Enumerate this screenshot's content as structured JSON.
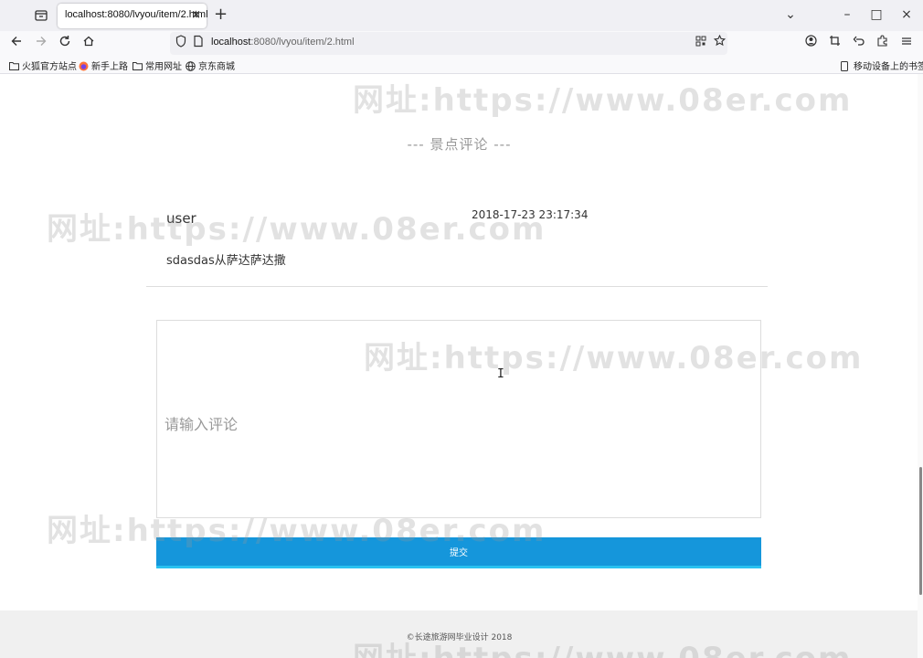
{
  "browser": {
    "tab_title": "localhost:8080/lvyou/item/2.html",
    "tab_close": "×",
    "new_tab": "+",
    "url_host": "localhost",
    "url_rest": ":8080/lvyou/item/2.html",
    "window_controls": {
      "collapse": "⌄",
      "minimize": "–",
      "maximize": "□",
      "close": "×"
    },
    "bookmarks": [
      {
        "label": "火狐官方站点",
        "icon": "folder-icon"
      },
      {
        "label": "新手上路",
        "icon": "firefox-icon"
      },
      {
        "label": "常用网址",
        "icon": "folder-icon"
      },
      {
        "label": "京东商城",
        "icon": "globe-icon"
      }
    ],
    "mobile_bookmarks": "移动设备上的书签"
  },
  "page": {
    "section_title": "--- 景点评论 ---",
    "comment": {
      "user": "user",
      "time": "2018-17-23 23:17:34",
      "text": "sdasdas从萨达萨达撒"
    },
    "comment_input": {
      "placeholder": "请输入评论",
      "value": ""
    },
    "submit_label": "提交",
    "footer": "©长途旅游网毕业设计 2018"
  },
  "watermark": "网址:https://www.08er.com",
  "colors": {
    "submit_button": "#1596db",
    "submit_border": "#2ac1f0",
    "footer_bg": "#f0f0f0"
  }
}
